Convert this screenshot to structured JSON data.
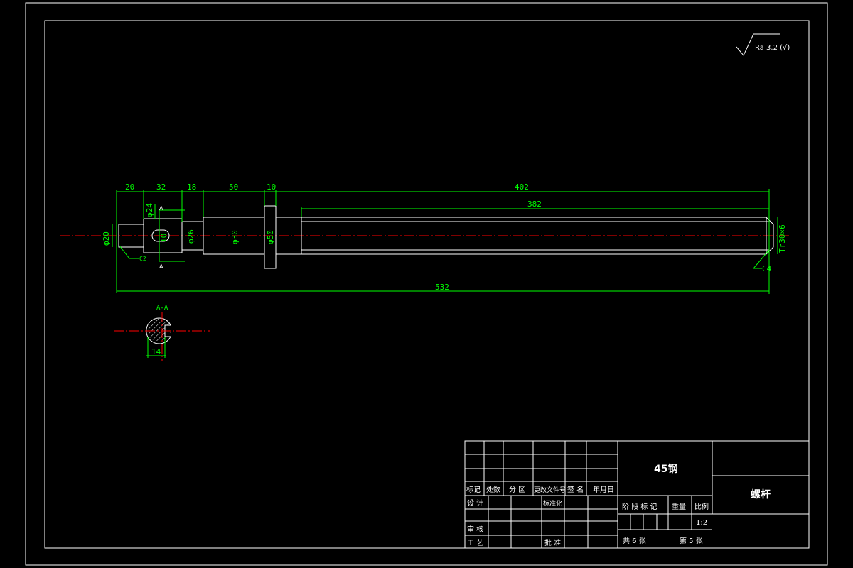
{
  "roughness": {
    "text": "Ra 3.2 (√)"
  },
  "dimensions": {
    "d20": "20",
    "d32": "32",
    "d18": "18",
    "d50": "50",
    "d10": "10",
    "d402": "402",
    "d382": "382",
    "d532": "532",
    "phi20": "φ20",
    "phi24": "φ24",
    "phi26": "φ26",
    "phi30": "φ30",
    "phi50": "φ50",
    "key10": "10",
    "c2": "C2",
    "c4": "C4",
    "thread": "Tr30×6",
    "section_a": "A",
    "section_title": "A-A",
    "section_width": "14"
  },
  "title_block": {
    "material": "45钢",
    "part_name": "螺杆",
    "headers": [
      "标记",
      "处数",
      "分 区",
      "更改文件号",
      "签 名",
      "年月日"
    ],
    "design": "设 计",
    "standardization": "标准化",
    "review": "审 核",
    "process": "工 艺",
    "approve": "批 准",
    "stage_mark": "阶 段 标 记",
    "weight": "重量",
    "scale_label": "比例",
    "scale_value": "1:2",
    "total_sheets": "共 6 张",
    "sheet_no": "第 5 张"
  }
}
